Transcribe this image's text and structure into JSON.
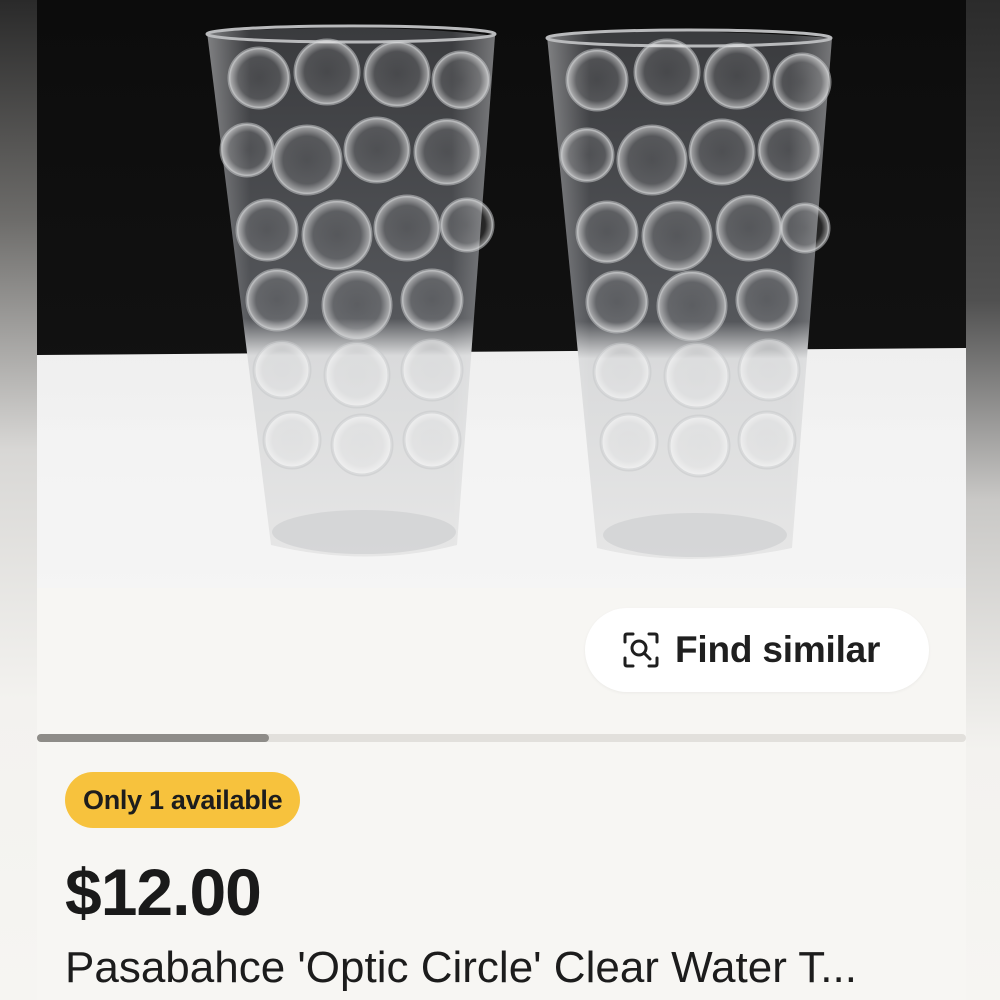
{
  "listing": {
    "photo_alt": "",
    "find_similar_label": "Find similar",
    "find_similar_icon": "visual-search-icon",
    "carousel_progress": 0.25,
    "availability_badge": "Only 1 available",
    "price": "$12.00",
    "title": "Pasabahce 'Optic Circle' Clear Water T..."
  },
  "colors": {
    "badge_bg": "#f7c23d",
    "page_bg": "#f7f6f3",
    "text": "#1c1c1c"
  }
}
